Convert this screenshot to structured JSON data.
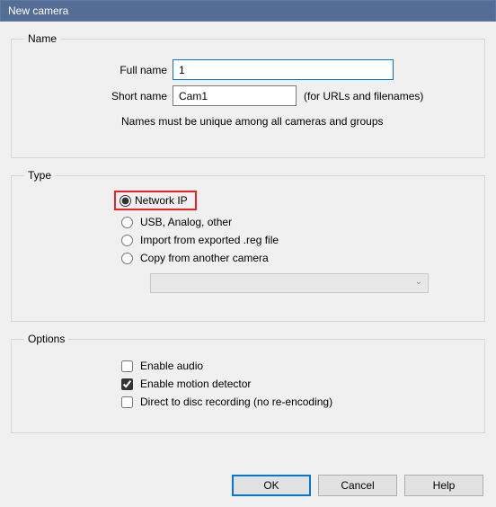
{
  "window": {
    "title": "New camera"
  },
  "name_group": {
    "legend": "Name",
    "full_name_label": "Full name",
    "full_name_value": "1",
    "short_name_label": "Short name",
    "short_name_value": "Cam1",
    "short_name_hint": "(for URLs and filenames)",
    "uniqueness_note": "Names must be unique among all cameras and groups"
  },
  "type_group": {
    "legend": "Type",
    "options": {
      "network_ip": "Network IP",
      "usb_analog": "USB, Analog, other",
      "import_reg": "Import from exported .reg file",
      "copy_camera": "Copy from another camera"
    },
    "selected": "network_ip",
    "copy_source_value": ""
  },
  "options_group": {
    "legend": "Options",
    "enable_audio": {
      "label": "Enable audio",
      "checked": false
    },
    "enable_motion": {
      "label": "Enable motion detector",
      "checked": true
    },
    "direct_disc": {
      "label": "Direct to disc recording (no re-encoding)",
      "checked": false
    }
  },
  "buttons": {
    "ok": "OK",
    "cancel": "Cancel",
    "help": "Help"
  }
}
